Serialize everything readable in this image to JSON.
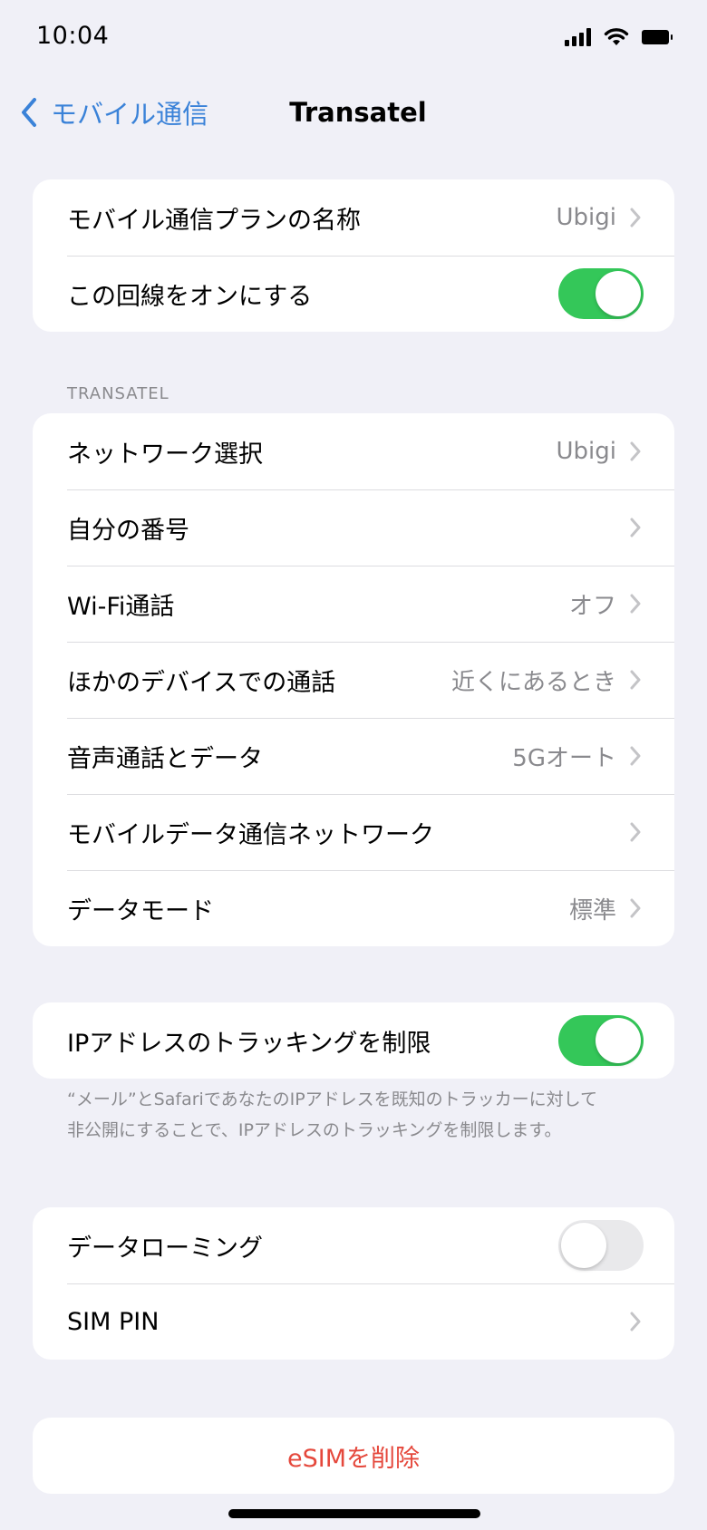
{
  "status": {
    "time": "10:04"
  },
  "nav": {
    "back_label": "モバイル通信",
    "title": "Transatel"
  },
  "group1": {
    "plan_name": {
      "label": "モバイル通信プランの名称",
      "value": "Ubigi"
    },
    "line_on": {
      "label": "この回線をオンにする",
      "state": "on"
    }
  },
  "section_header": "TRANSATEL",
  "group2": [
    {
      "label": "ネットワーク選択",
      "value": "Ubigi"
    },
    {
      "label": "自分の番号",
      "value": ""
    },
    {
      "label": "Wi-Fi通話",
      "value": "オフ"
    },
    {
      "label": "ほかのデバイスでの通話",
      "value": "近くにあるとき"
    },
    {
      "label": "音声通話とデータ",
      "value": "5Gオート"
    },
    {
      "label": "モバイルデータ通信ネットワーク",
      "value": ""
    },
    {
      "label": "データモード",
      "value": "標準"
    }
  ],
  "ip_tracking": {
    "label": "IPアドレスのトラッキングを制限",
    "state": "on"
  },
  "footnote": "“メール”とSafariであなたのIPアドレスを既知のトラッカーに対して非公開にすることで、IPアドレスのトラッキングを制限します。",
  "group4": {
    "data_roaming": {
      "label": "データローミング",
      "state": "off"
    },
    "sim_pin": {
      "label": "SIM PIN"
    }
  },
  "delete_esim": "eSIMを削除",
  "colors": {
    "accent": "#3a82d8",
    "toggle_on": "#34c759",
    "destructive": "#e5483c",
    "background": "#f0f0f7"
  }
}
